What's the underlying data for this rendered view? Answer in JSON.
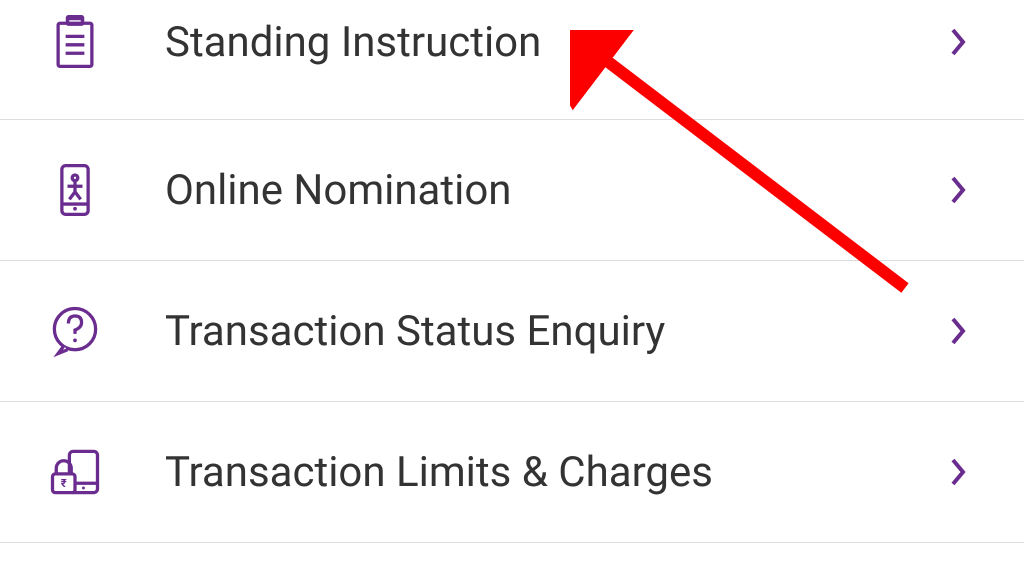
{
  "menu": {
    "items": [
      {
        "label": "Standing Instruction",
        "icon": "clipboard-icon"
      },
      {
        "label": "Online Nomination",
        "icon": "phone-person-icon"
      },
      {
        "label": "Transaction Status Enquiry",
        "icon": "question-bubble-icon"
      },
      {
        "label": "Transaction Limits & Charges",
        "icon": "lock-device-icon"
      }
    ]
  },
  "colors": {
    "accent": "#6a2d8f",
    "text": "#333333",
    "annotation": "#fc0000"
  }
}
